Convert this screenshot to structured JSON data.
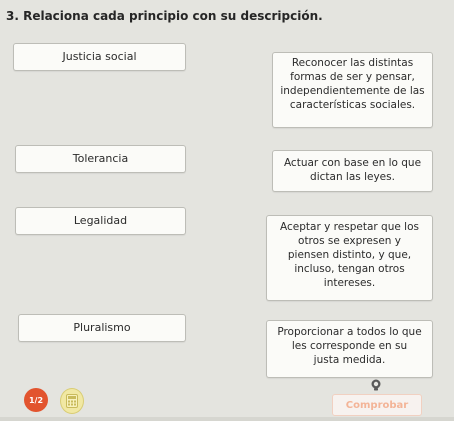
{
  "question": {
    "title": "3. Relaciona cada principio con su descripción."
  },
  "pairs": [
    {
      "term": "Justicia social",
      "description_lines": [
        "Reconocer las distintas",
        "formas de ser y pensar,",
        "independientemente de las",
        "características sociales."
      ]
    },
    {
      "term": "Tolerancia",
      "description_lines": [
        "Actuar con base en lo que",
        "dictan las leyes."
      ]
    },
    {
      "term": "Legalidad",
      "description_lines": [
        "Aceptar y respetar que los",
        "otros se expresen y",
        "piensen distinto, y que,",
        "incluso, tengan otros",
        "intereses."
      ]
    },
    {
      "term": "Pluralismo",
      "description_lines": [
        "Proporcionar a todos lo que",
        "les corresponde en su",
        "justa medida."
      ]
    }
  ],
  "footer": {
    "page_indicator": "1/2",
    "calculator_icon": "calculator-icon",
    "hint_icon": "lightbulb-icon",
    "check_label": "Comprobar",
    "accent_color": "#e2542e",
    "check_disabled_color": "#f3b497"
  }
}
